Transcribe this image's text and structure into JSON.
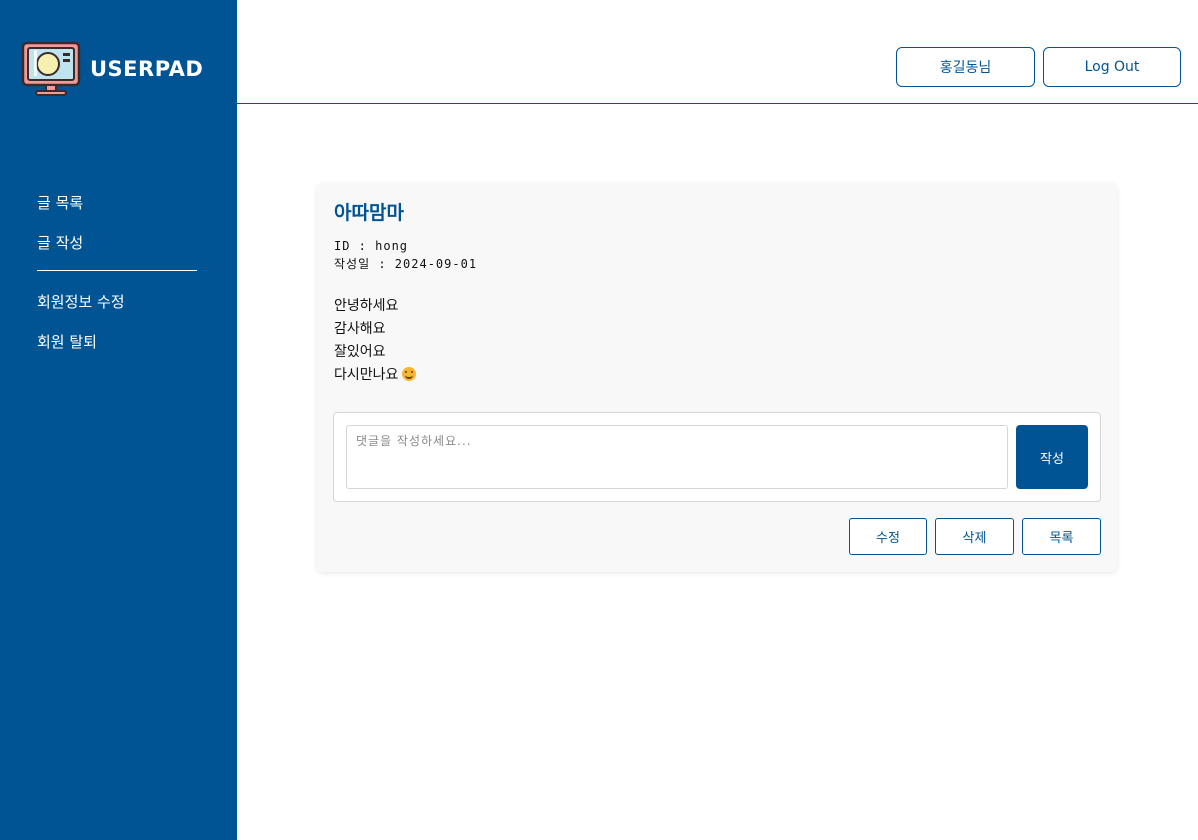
{
  "brand": {
    "name": "USERPAD",
    "icon": "monitor-icon"
  },
  "sidebar": {
    "items": [
      {
        "label": "글 목록"
      },
      {
        "label": "글 작성"
      },
      {
        "label": "회원정보 수정"
      },
      {
        "label": "회원 탈퇴"
      }
    ]
  },
  "header": {
    "user_label": "홍길동님",
    "logout_label": "Log Out"
  },
  "post": {
    "title": "아따맘마",
    "id_line": "ID : hong",
    "date_line": "작성일 : 2024-09-01",
    "lines": [
      "안녕하세요",
      "감사해요",
      "잘있어요",
      "다시만나요"
    ],
    "emoji": "smiling-face-icon"
  },
  "comment": {
    "placeholder": "댓글을 작성하세요...",
    "submit_label": "작성"
  },
  "actions": {
    "edit_label": "수정",
    "delete_label": "삭제",
    "list_label": "목록"
  },
  "colors": {
    "primary": "#005494",
    "card_bg": "#f8f8f8"
  }
}
